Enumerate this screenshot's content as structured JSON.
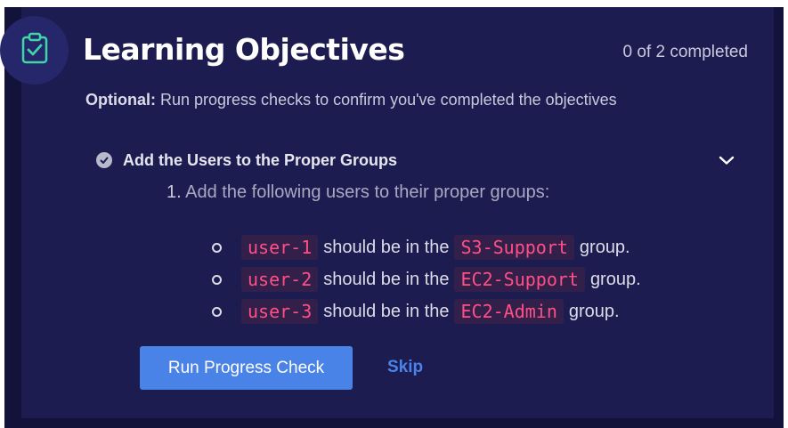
{
  "header": {
    "title": "Learning Objectives",
    "progress": "0 of 2 completed",
    "icon": "clipboard-check-icon"
  },
  "subtitle": {
    "prefix": "Optional:",
    "text": " Run progress checks to confirm you've completed the objectives"
  },
  "objective": {
    "title": "Add the Users to the Proper Groups",
    "step_number": "1.",
    "step_text": "Add the following users to their proper groups:",
    "items": [
      {
        "user": "user-1",
        "middle": "should be in the",
        "group": "S3-Support",
        "suffix": "group."
      },
      {
        "user": "user-2",
        "middle": "should be in the",
        "group": "EC2-Support",
        "suffix": "group."
      },
      {
        "user": "user-3",
        "middle": "should be in the",
        "group": "EC2-Admin",
        "suffix": "group."
      }
    ]
  },
  "actions": {
    "run_label": "Run Progress Check",
    "skip_label": "Skip"
  },
  "colors": {
    "background": "#1c1c50",
    "accent": "#4a83e8",
    "code_text": "#ff4f86",
    "icon_teal": "#3fd6a8"
  }
}
